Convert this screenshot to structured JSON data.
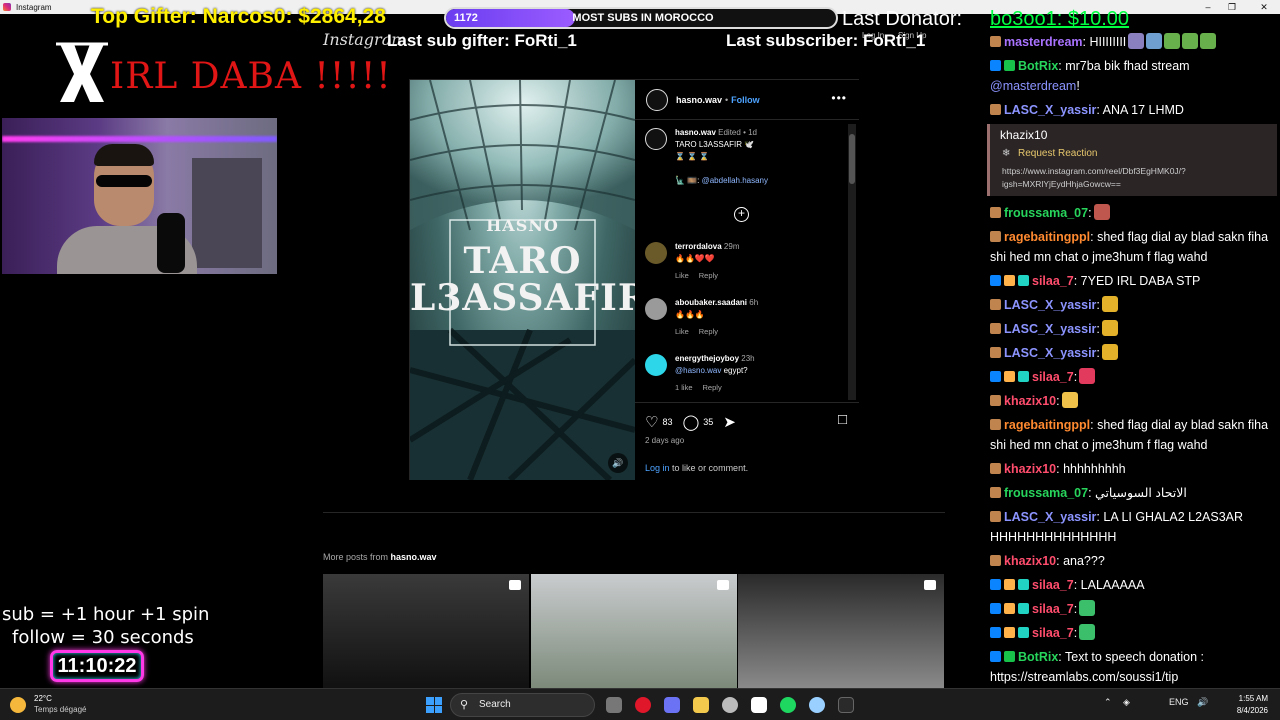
{
  "window": {
    "title": "Instagram"
  },
  "overlay": {
    "top_gifter": "Top Gifter: Narcos0: $2864,28",
    "sub_goal": {
      "count": "1172",
      "label": "MOST SUBS IN MOROCCO",
      "fill_fraction": 0.33
    },
    "last_donator_label": "Last Donator:",
    "last_donator_value": "bo3oo1: $10.00",
    "last_sub_gifter": "Last sub gifter: FoRti_1",
    "last_subscriber": "Last subscriber: FoRti_1",
    "channel_title": "IRL DABA !!!!!",
    "sub_rule": "sub  = +1 hour +1 spin",
    "follow_rule": "follow = 30 seconds",
    "timer": "11:10:22"
  },
  "instagram": {
    "logo": "Instagram",
    "login": "Log In",
    "signup": "Sign Up",
    "post": {
      "media_brand": "HASNO",
      "media_title_1": "TARO",
      "media_title_2": "L3ASSAFIR",
      "author": "hasno.wav",
      "follow": "Follow",
      "caption": {
        "user": "hasno.wav",
        "edited": "Edited",
        "age": "1d",
        "line1": "TARO L3ASSAFIR 🕊️",
        "line2": "⌛ ⌛ ⌛",
        "credit_prefix": "🗽 🎞️:",
        "credit_link": "@abdellah.hasany"
      },
      "comments": [
        {
          "user": "terrordalova",
          "age": "29m",
          "text": "🔥🔥❤️❤️",
          "likes": "",
          "reply": "Reply",
          "like": "Like",
          "color": "#6a5a2a"
        },
        {
          "user": "aboubaker.saadani",
          "age": "6h",
          "text": "🔥🔥🔥",
          "likes": "",
          "reply": "Reply",
          "like": "Like",
          "color": "#9a9a9a"
        },
        {
          "user": "energythejoyboy",
          "age": "23h",
          "mention": "@hasno.wav",
          "text": "egypt?",
          "likes": "1 like",
          "reply": "Reply",
          "color": "#2dd6e8"
        }
      ],
      "likes": "83",
      "comments_count": "35",
      "posted": "2 days ago",
      "login_link": "Log in",
      "login_rest": "to like or comment."
    },
    "more_posts_prefix": "More posts from",
    "more_posts_user": "hasno.wav"
  },
  "chat": [
    {
      "user": "masterdream",
      "color": "#a972ff",
      "badges": [
        "pin"
      ],
      "text": ": HIIIIIIII",
      "emotes": [
        "#8a7fbf",
        "#6e9fd0",
        "#67b04c",
        "#67b04c",
        "#67b04c"
      ]
    },
    {
      "user": "BotRix",
      "color": "#27d45c",
      "badges": [
        "prime",
        "check"
      ],
      "text": ": mr7ba bik fhad stream",
      "mention": "@masterdream",
      "after": "!"
    },
    {
      "user": "LASC_X_yassir",
      "color": "#8c94ff",
      "badges": [
        "pin"
      ],
      "text": ": ANA 17 LHMD"
    },
    {
      "redeem": true,
      "user": "khazix10",
      "reward": "Request Reaction",
      "url": "https://www.instagram.com/reel/Dbf3EgHMK0J/?igsh=MXRlYjEydHhjaGowcw=="
    },
    {
      "user": "froussama_07",
      "color": "#27d45c",
      "badges": [
        "pin"
      ],
      "text": ":",
      "emotes": [
        "#c0574e"
      ]
    },
    {
      "user": "ragebaitingppl",
      "color": "#ff8a30",
      "badges": [
        "pin"
      ],
      "text": ": shed flag dial ay blad sakn fiha shi hed mn chat o jme3hum f flag wahd"
    },
    {
      "user": "silaa_7",
      "color": "#ff4d6d",
      "badges": [
        "prime",
        "skull",
        "gift"
      ],
      "text": ": 7YED IRL DABA STP"
    },
    {
      "user": "LASC_X_yassir",
      "color": "#8c94ff",
      "badges": [
        "pin"
      ],
      "text": ":",
      "emotes": [
        "#e3b22a"
      ]
    },
    {
      "user": "LASC_X_yassir",
      "color": "#8c94ff",
      "badges": [
        "pin"
      ],
      "text": ":",
      "emotes": [
        "#e3b22a"
      ]
    },
    {
      "user": "LASC_X_yassir",
      "color": "#8c94ff",
      "badges": [
        "pin"
      ],
      "text": ":",
      "emotes": [
        "#e3b22a"
      ]
    },
    {
      "user": "silaa_7",
      "color": "#ff4d6d",
      "badges": [
        "prime",
        "skull",
        "gift"
      ],
      "text": ":",
      "emotes": [
        "#e23a5c"
      ]
    },
    {
      "user": "khazix10",
      "color": "#ff4d6d",
      "badges": [
        "pin"
      ],
      "text": ":",
      "emotes": [
        "#f0c24a"
      ]
    },
    {
      "user": "ragebaitingppl",
      "color": "#ff8a30",
      "badges": [
        "pin"
      ],
      "text": ": shed flag dial ay blad sakn fiha shi hed mn chat o jme3hum f flag wahd"
    },
    {
      "user": "khazix10",
      "color": "#ff4d6d",
      "badges": [
        "pin"
      ],
      "text": ": hhhhhhhhh"
    },
    {
      "user": "froussama_07",
      "color": "#27d45c",
      "badges": [
        "pin"
      ],
      "text": ": الاتحاد السوسياتي"
    },
    {
      "user": "LASC_X_yassir",
      "color": "#8c94ff",
      "badges": [
        "pin"
      ],
      "text": ": LA LI GHALA2 L2AS3AR HHHHHHHHHHHHHH"
    },
    {
      "user": "khazix10",
      "color": "#ff4d6d",
      "badges": [
        "pin"
      ],
      "text": ": ana???"
    },
    {
      "user": "silaa_7",
      "color": "#ff4d6d",
      "badges": [
        "prime",
        "skull",
        "gift"
      ],
      "text": ": LALAAAAA"
    },
    {
      "user": "silaa_7",
      "color": "#ff4d6d",
      "badges": [
        "prime",
        "skull",
        "gift"
      ],
      "text": ":",
      "emotes": [
        "#3cbf6a"
      ]
    },
    {
      "user": "silaa_7",
      "color": "#ff4d6d",
      "badges": [
        "prime",
        "skull",
        "gift"
      ],
      "text": ":",
      "emotes": [
        "#3cbf6a"
      ]
    },
    {
      "user": "BotRix",
      "color": "#27d45c",
      "badges": [
        "prime",
        "check"
      ],
      "text": ": Text to speech donation : https://streamlabs.com/soussi1/tip"
    }
  ],
  "taskbar": {
    "temp": "22°C",
    "condition": "Temps dégagé",
    "search": "Search",
    "lang": "ENG",
    "time": "1:55 AM",
    "date": "8/4/2026"
  }
}
